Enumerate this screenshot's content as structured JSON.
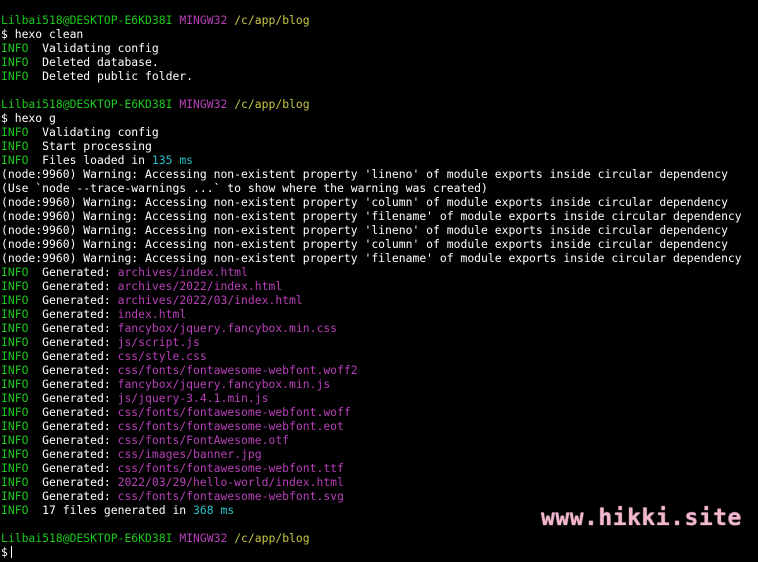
{
  "prompt_1": {
    "user": "Lilbai518@DESKTOP-E6KD38I",
    "shell": "MINGW32",
    "path": "/c/app/blog"
  },
  "command_1": "$ hexo clean",
  "clean_output": [
    {
      "tag": "INFO",
      "text": "Validating config"
    },
    {
      "tag": "INFO",
      "text": "Deleted database."
    },
    {
      "tag": "INFO",
      "text": "Deleted public folder."
    }
  ],
  "prompt_2": {
    "user": "Lilbai518@DESKTOP-E6KD38I",
    "shell": "MINGW32",
    "path": "/c/app/blog"
  },
  "command_2": "$ hexo g",
  "gen_info": [
    {
      "tag": "INFO",
      "text": "Validating config"
    },
    {
      "tag": "INFO",
      "text": "Start processing"
    }
  ],
  "files_loaded": {
    "tag": "INFO",
    "prefix": "Files loaded in",
    "value": "135",
    "unit": "ms"
  },
  "warnings": [
    "(node:9960) Warning: Accessing non-existent property 'lineno' of module exports inside circular dependency",
    "(Use `node --trace-warnings ...` to show where the warning was created)",
    "(node:9960) Warning: Accessing non-existent property 'column' of module exports inside circular dependency",
    "(node:9960) Warning: Accessing non-existent property 'filename' of module exports inside circular dependency",
    "(node:9960) Warning: Accessing non-existent property 'lineno' of module exports inside circular dependency",
    "(node:9960) Warning: Accessing non-existent property 'column' of module exports inside circular dependency",
    "(node:9960) Warning: Accessing non-existent property 'filename' of module exports inside circular dependency"
  ],
  "generated_label": "Generated:",
  "generated_tag": "INFO",
  "generated_files": [
    "archives/index.html",
    "archives/2022/index.html",
    "archives/2022/03/index.html",
    "index.html",
    "fancybox/jquery.fancybox.min.css",
    "js/script.js",
    "css/style.css",
    "css/fonts/fontawesome-webfont.woff2",
    "fancybox/jquery.fancybox.min.js",
    "js/jquery-3.4.1.min.js",
    "css/fonts/fontawesome-webfont.woff",
    "css/fonts/fontawesome-webfont.eot",
    "css/fonts/FontAwesome.otf",
    "css/images/banner.jpg",
    "css/fonts/fontawesome-webfont.ttf",
    "2022/03/29/hello-world/index.html",
    "css/fonts/fontawesome-webfont.svg"
  ],
  "summary": {
    "tag": "INFO",
    "prefix": "17 files generated in",
    "value": "368",
    "unit": "ms"
  },
  "prompt_3": {
    "user": "Lilbai518@DESKTOP-E6KD38I",
    "shell": "MINGW32",
    "path": "/c/app/blog"
  },
  "input_prompt": "$",
  "watermark": "www.hikki.site",
  "colors": {
    "background": "#000000",
    "info": "#1bc91b",
    "path_magenta": "#b83fb8",
    "cwd_yellow": "#c7c746",
    "number_cyan": "#26c1c9",
    "watermark_pink": "#f3b6cf"
  }
}
